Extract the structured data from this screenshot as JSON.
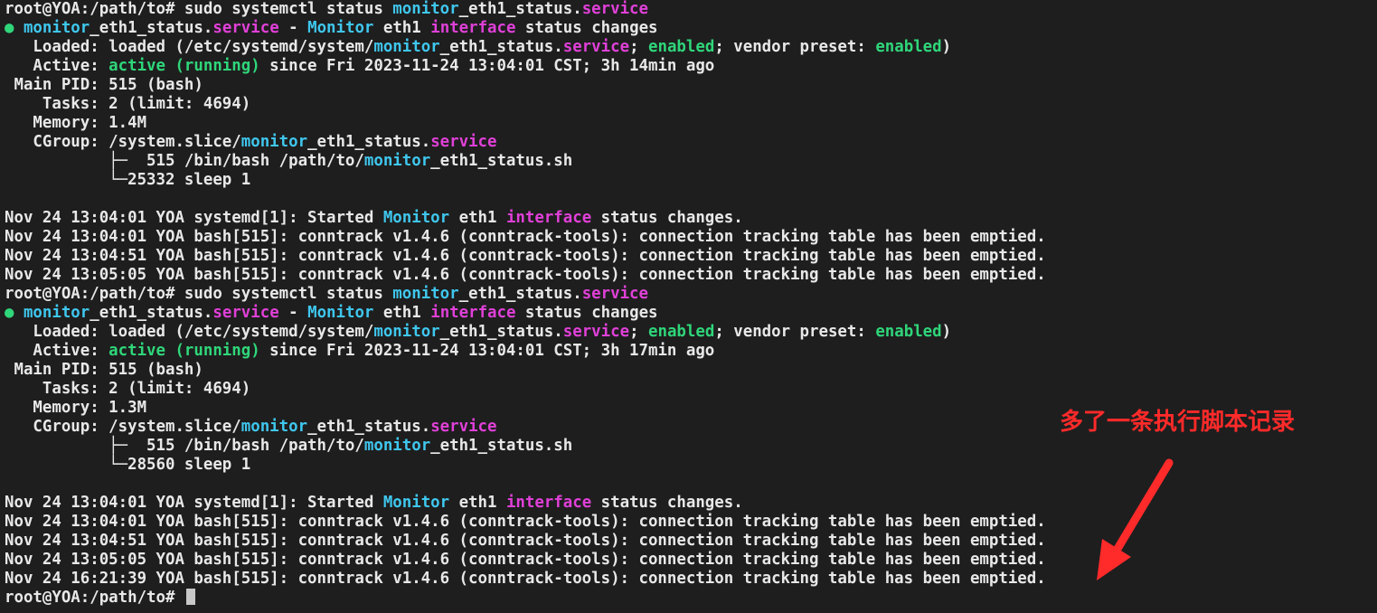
{
  "terminal": {
    "lines": [
      [
        {
          "t": "root@YOA:/path/to# sudo systemctl status ",
          "c": "default"
        },
        {
          "t": "monitor",
          "c": "cyan"
        },
        {
          "t": "_eth1_status.",
          "c": "default"
        },
        {
          "t": "service",
          "c": "magenta"
        }
      ],
      [
        {
          "t": "● ",
          "c": "dot"
        },
        {
          "t": "monitor",
          "c": "cyan"
        },
        {
          "t": "_eth1_status.",
          "c": "default"
        },
        {
          "t": "service",
          "c": "magenta"
        },
        {
          "t": " - ",
          "c": "default"
        },
        {
          "t": "Monitor",
          "c": "cyan"
        },
        {
          "t": " eth1 ",
          "c": "default"
        },
        {
          "t": "interface",
          "c": "magenta"
        },
        {
          "t": " status changes",
          "c": "default"
        }
      ],
      [
        {
          "t": "   Loaded: loaded (/etc/systemd/system/",
          "c": "default"
        },
        {
          "t": "monitor",
          "c": "cyan"
        },
        {
          "t": "_eth1_status.",
          "c": "default"
        },
        {
          "t": "service",
          "c": "magenta"
        },
        {
          "t": "; ",
          "c": "default"
        },
        {
          "t": "enabled",
          "c": "green"
        },
        {
          "t": "; vendor preset: ",
          "c": "default"
        },
        {
          "t": "enabled",
          "c": "green"
        },
        {
          "t": ")",
          "c": "default"
        }
      ],
      [
        {
          "t": "   Active: ",
          "c": "default"
        },
        {
          "t": "active (running)",
          "c": "green"
        },
        {
          "t": " since Fri 2023-11-24 13:04:01 CST; 3h 14min ago",
          "c": "default"
        }
      ],
      [
        {
          "t": " Main PID: 515 (bash)",
          "c": "default"
        }
      ],
      [
        {
          "t": "    Tasks: 2 (limit: 4694)",
          "c": "default"
        }
      ],
      [
        {
          "t": "   Memory: 1.4M",
          "c": "default"
        }
      ],
      [
        {
          "t": "   CGroup: /system.slice/",
          "c": "default"
        },
        {
          "t": "monitor",
          "c": "cyan"
        },
        {
          "t": "_eth1_status.",
          "c": "default"
        },
        {
          "t": "service",
          "c": "magenta"
        }
      ],
      [
        {
          "t": "           ├─  515 /bin/bash /path/to/",
          "c": "default"
        },
        {
          "t": "monitor",
          "c": "cyan"
        },
        {
          "t": "_eth1_status.sh",
          "c": "default"
        }
      ],
      [
        {
          "t": "           └─25332 sleep 1",
          "c": "default"
        }
      ],
      [
        {
          "t": "",
          "c": "default"
        }
      ],
      [
        {
          "t": "Nov 24 13:04:01 YOA systemd[1]: Started ",
          "c": "default"
        },
        {
          "t": "Monitor",
          "c": "cyan"
        },
        {
          "t": " eth1 ",
          "c": "default"
        },
        {
          "t": "interface",
          "c": "magenta"
        },
        {
          "t": " status changes.",
          "c": "default"
        }
      ],
      [
        {
          "t": "Nov 24 13:04:01 YOA bash[515]: conntrack v1.4.6 (conntrack-tools): connection tracking table has been emptied.",
          "c": "default"
        }
      ],
      [
        {
          "t": "Nov 24 13:04:51 YOA bash[515]: conntrack v1.4.6 (conntrack-tools): connection tracking table has been emptied.",
          "c": "default"
        }
      ],
      [
        {
          "t": "Nov 24 13:05:05 YOA bash[515]: conntrack v1.4.6 (conntrack-tools): connection tracking table has been emptied.",
          "c": "default"
        }
      ],
      [
        {
          "t": "root@YOA:/path/to# sudo systemctl status ",
          "c": "default"
        },
        {
          "t": "monitor",
          "c": "cyan"
        },
        {
          "t": "_eth1_status.",
          "c": "default"
        },
        {
          "t": "service",
          "c": "magenta"
        }
      ],
      [
        {
          "t": "● ",
          "c": "dot"
        },
        {
          "t": "monitor",
          "c": "cyan"
        },
        {
          "t": "_eth1_status.",
          "c": "default"
        },
        {
          "t": "service",
          "c": "magenta"
        },
        {
          "t": " - ",
          "c": "default"
        },
        {
          "t": "Monitor",
          "c": "cyan"
        },
        {
          "t": " eth1 ",
          "c": "default"
        },
        {
          "t": "interface",
          "c": "magenta"
        },
        {
          "t": " status changes",
          "c": "default"
        }
      ],
      [
        {
          "t": "   Loaded: loaded (/etc/systemd/system/",
          "c": "default"
        },
        {
          "t": "monitor",
          "c": "cyan"
        },
        {
          "t": "_eth1_status.",
          "c": "default"
        },
        {
          "t": "service",
          "c": "magenta"
        },
        {
          "t": "; ",
          "c": "default"
        },
        {
          "t": "enabled",
          "c": "green"
        },
        {
          "t": "; vendor preset: ",
          "c": "default"
        },
        {
          "t": "enabled",
          "c": "green"
        },
        {
          "t": ")",
          "c": "default"
        }
      ],
      [
        {
          "t": "   Active: ",
          "c": "default"
        },
        {
          "t": "active (running)",
          "c": "green"
        },
        {
          "t": " since Fri 2023-11-24 13:04:01 CST; 3h 17min ago",
          "c": "default"
        }
      ],
      [
        {
          "t": " Main PID: 515 (bash)",
          "c": "default"
        }
      ],
      [
        {
          "t": "    Tasks: 2 (limit: 4694)",
          "c": "default"
        }
      ],
      [
        {
          "t": "   Memory: 1.3M",
          "c": "default"
        }
      ],
      [
        {
          "t": "   CGroup: /system.slice/",
          "c": "default"
        },
        {
          "t": "monitor",
          "c": "cyan"
        },
        {
          "t": "_eth1_status.",
          "c": "default"
        },
        {
          "t": "service",
          "c": "magenta"
        }
      ],
      [
        {
          "t": "           ├─  515 /bin/bash /path/to/",
          "c": "default"
        },
        {
          "t": "monitor",
          "c": "cyan"
        },
        {
          "t": "_eth1_status.sh",
          "c": "default"
        }
      ],
      [
        {
          "t": "           └─28560 sleep 1",
          "c": "default"
        }
      ],
      [
        {
          "t": "",
          "c": "default"
        }
      ],
      [
        {
          "t": "Nov 24 13:04:01 YOA systemd[1]: Started ",
          "c": "default"
        },
        {
          "t": "Monitor",
          "c": "cyan"
        },
        {
          "t": " eth1 ",
          "c": "default"
        },
        {
          "t": "interface",
          "c": "magenta"
        },
        {
          "t": " status changes.",
          "c": "default"
        }
      ],
      [
        {
          "t": "Nov 24 13:04:01 YOA bash[515]: conntrack v1.4.6 (conntrack-tools): connection tracking table has been emptied.",
          "c": "default"
        }
      ],
      [
        {
          "t": "Nov 24 13:04:51 YOA bash[515]: conntrack v1.4.6 (conntrack-tools): connection tracking table has been emptied.",
          "c": "default"
        }
      ],
      [
        {
          "t": "Nov 24 13:05:05 YOA bash[515]: conntrack v1.4.6 (conntrack-tools): connection tracking table has been emptied.",
          "c": "default"
        }
      ],
      [
        {
          "t": "Nov 24 16:21:39 YOA bash[515]: conntrack v1.4.6 (conntrack-tools): connection tracking table has been emptied.",
          "c": "default"
        }
      ],
      [
        {
          "t": "root@YOA:/path/to# ",
          "c": "default"
        }
      ]
    ]
  },
  "annotation": {
    "text": "多了一条执行脚本记录",
    "color": "#ff2a2a",
    "arrow_icon": "red-arrow-icon"
  },
  "colors": {
    "background": "#1e1e1e",
    "text": "#e8e8e8",
    "cyan": "#3fc7ee",
    "magenta": "#e040d8",
    "green": "#2fd67a"
  }
}
